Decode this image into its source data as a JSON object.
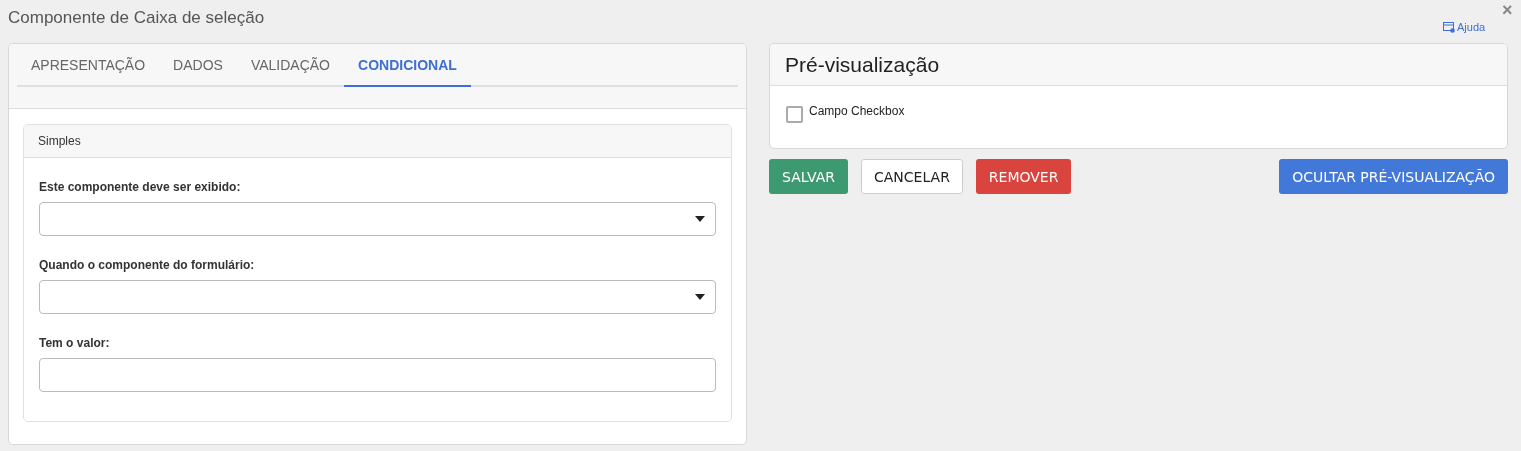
{
  "window": {
    "title": "Componente de Caixa de seleção",
    "help_link": "Ajuda",
    "close": "×"
  },
  "tabs": [
    {
      "label": "APRESENTAÇÃO",
      "selected": false
    },
    {
      "label": "DADOS",
      "selected": false
    },
    {
      "label": "VALIDAÇÃO",
      "selected": false
    },
    {
      "label": "CONDICIONAL",
      "selected": true
    }
  ],
  "conditional_panel": {
    "title": "Simples",
    "fields": [
      {
        "kind": "select",
        "label": "Este componente deve ser exibido:"
      },
      {
        "kind": "select",
        "label": "Quando o componente do formulário:"
      },
      {
        "kind": "text",
        "label": "Tem o valor:"
      }
    ]
  },
  "preview": {
    "title": "Pré-visualização",
    "checkbox": {
      "label": "Campo Checkbox",
      "checked": false
    }
  },
  "buttons": [
    {
      "label": "SALVAR",
      "kind": "success"
    },
    {
      "label": "CANCELAR",
      "kind": "default"
    },
    {
      "label": "REMOVER",
      "kind": "danger"
    },
    {
      "label": "OCULTAR PRÉ-VISUALIZAÇÃO",
      "kind": "primary"
    }
  ]
}
